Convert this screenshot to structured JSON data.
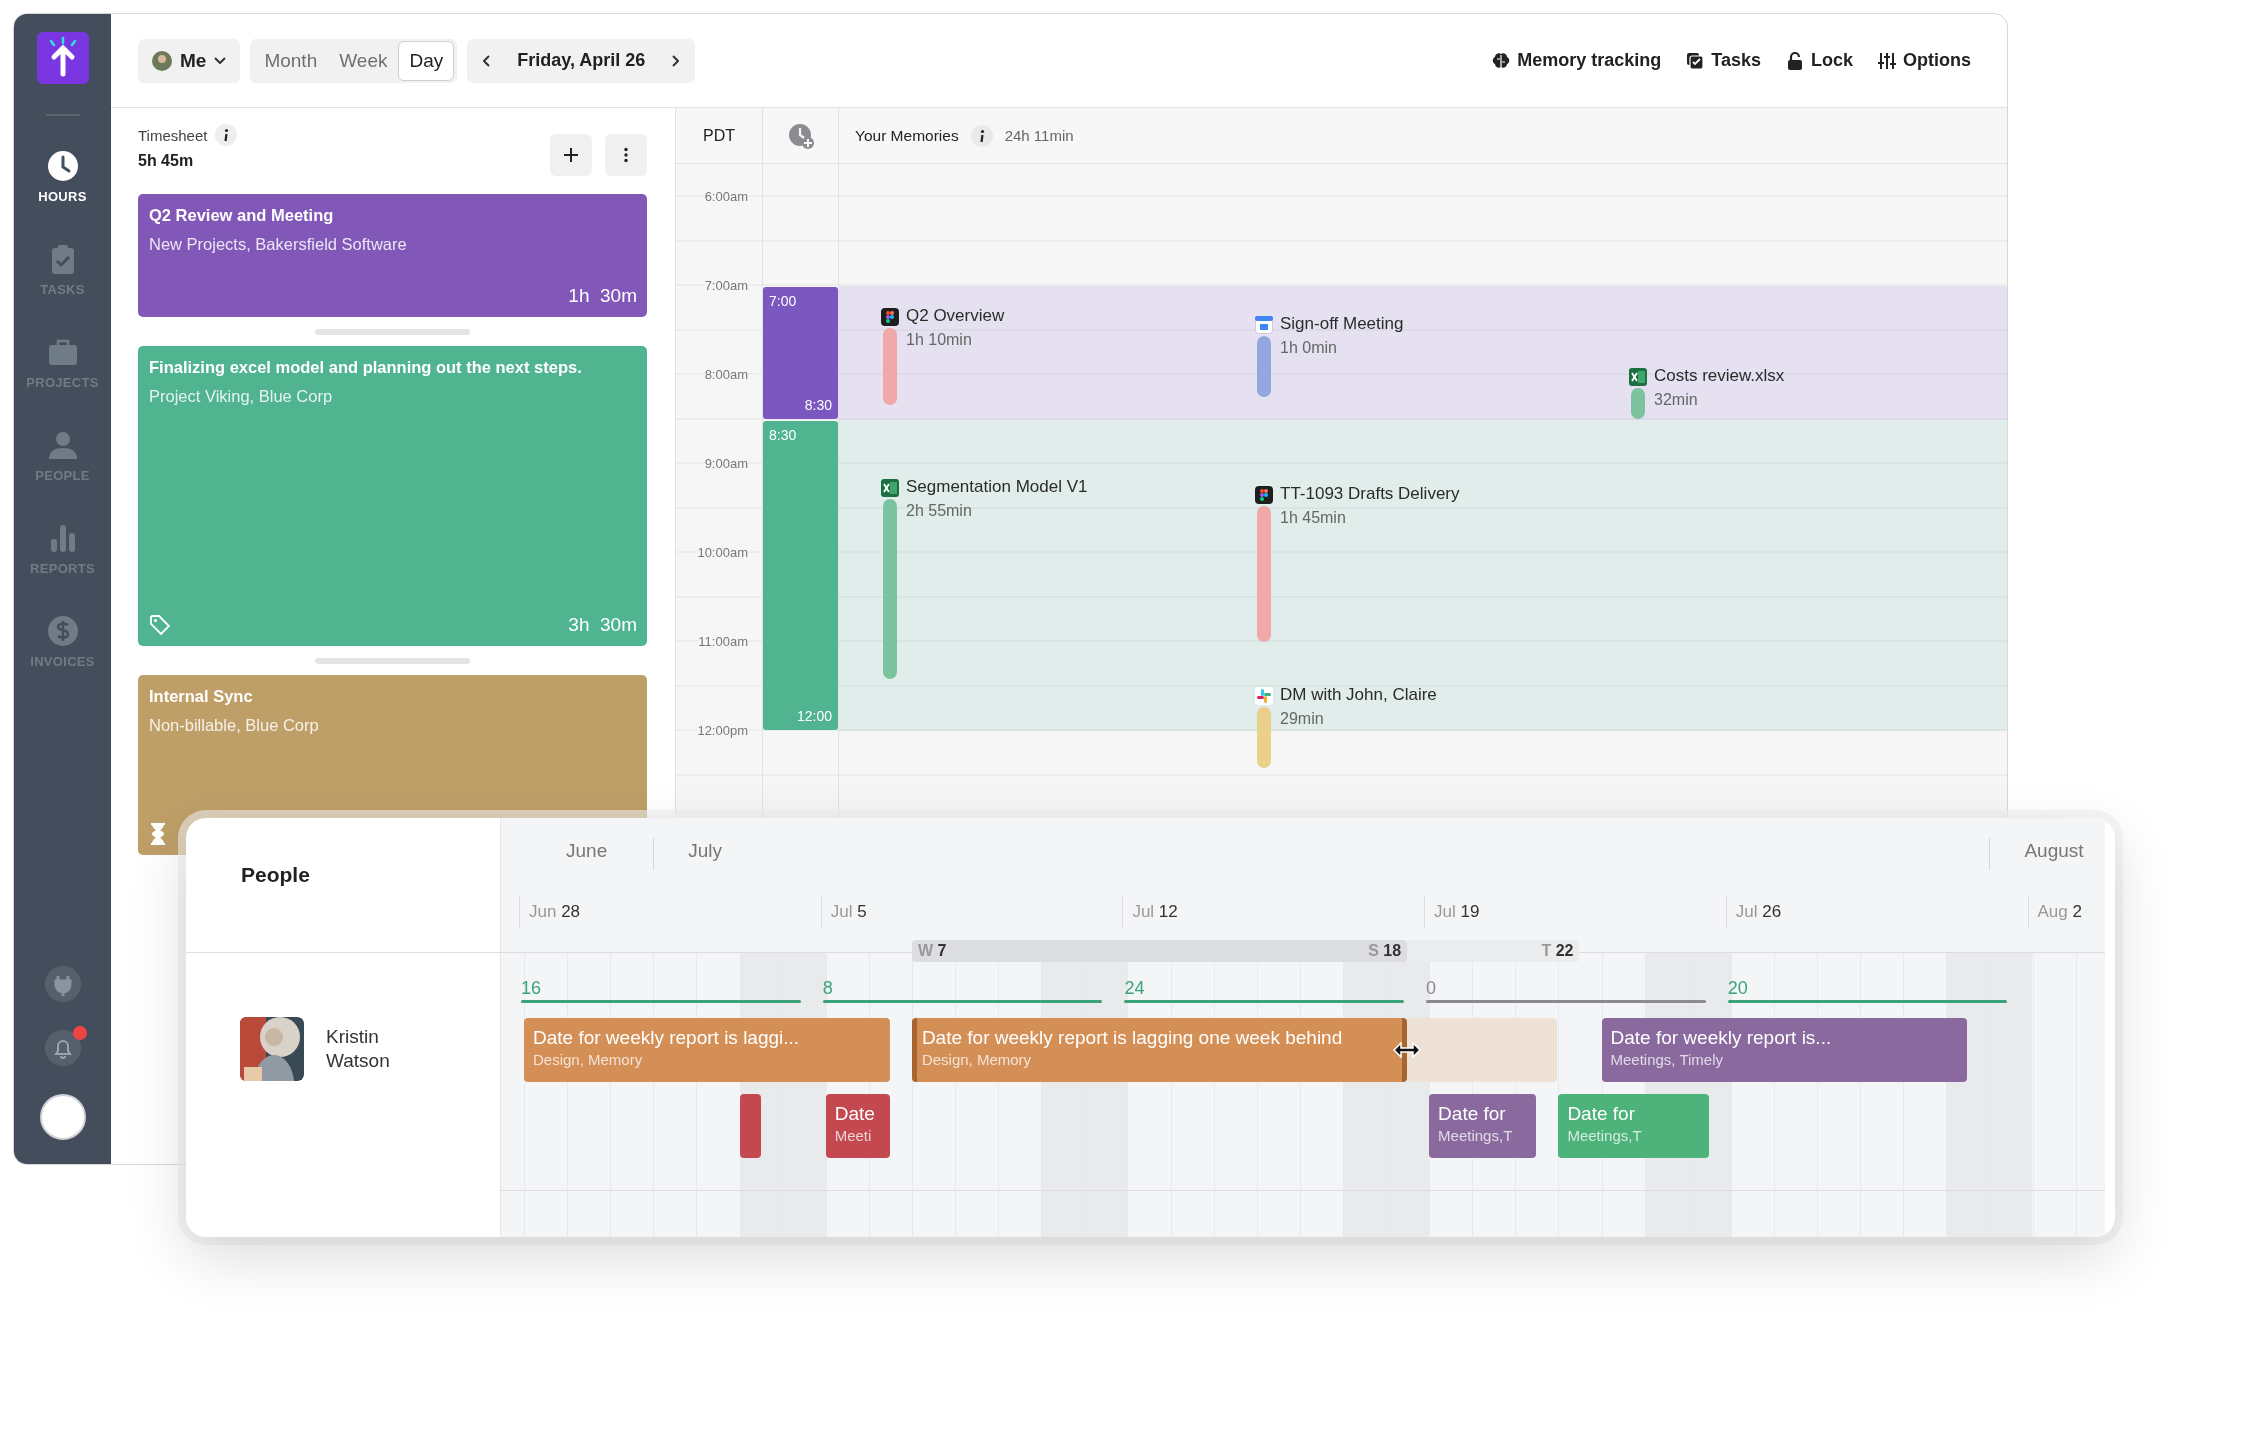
{
  "sidebar": {
    "nav": [
      {
        "label": "HOURS",
        "selected": true
      },
      {
        "label": "TASKS",
        "selected": false
      },
      {
        "label": "PROJECTS",
        "selected": false
      },
      {
        "label": "PEOPLE",
        "selected": false
      },
      {
        "label": "REPORTS",
        "selected": false
      },
      {
        "label": "INVOICES",
        "selected": false
      }
    ],
    "notifications_unread": true
  },
  "toolbar": {
    "user": "Me",
    "views": [
      {
        "label": "Month",
        "selected": false
      },
      {
        "label": "Week",
        "selected": false
      },
      {
        "label": "Day",
        "selected": true
      }
    ],
    "date": "Friday, April 26",
    "actions": [
      {
        "label": "Memory tracking"
      },
      {
        "label": "Tasks"
      },
      {
        "label": "Lock"
      },
      {
        "label": "Options"
      }
    ]
  },
  "timesheet": {
    "title": "Timesheet",
    "total": "5h 45m",
    "entries": [
      {
        "title": "Q2 Review and Meeting",
        "subtitle": "New Projects, Bakersfield Software",
        "duration": "1h  30m",
        "color": "#8157b8"
      },
      {
        "title": "Finalizing excel model and planning out the next steps.",
        "subtitle": "Project Viking, Blue Corp",
        "duration": "3h  30m",
        "color": "#50b490"
      },
      {
        "title": "Internal Sync",
        "subtitle": "Non-billable, Blue Corp",
        "color": "#bf9f68"
      }
    ]
  },
  "calendar": {
    "timezone": "PDT",
    "title": "Your Memories",
    "total": "24h 11min",
    "hours": [
      "6:00am",
      "7:00am",
      "8:00am",
      "9:00am",
      "10:00am",
      "11:00am",
      "12:00pm"
    ],
    "blocks": [
      {
        "start": "7:00",
        "end": "8:30",
        "color": "#7b57c0"
      },
      {
        "start": "8:30",
        "end": "12:00",
        "color": "#4fb48f"
      }
    ],
    "lanes": [
      [
        {
          "title": "Q2 Overview",
          "duration": "1h 10min",
          "color": "#f0a8a8"
        },
        {
          "title": "Segmentation Model V1",
          "duration": "2h 55min",
          "color": "#7cc4a0"
        }
      ],
      [
        {
          "title": "Sign-off Meeting",
          "duration": "1h 0min",
          "color": "#94a6de"
        },
        {
          "title": "TT-1093 Drafts Delivery",
          "duration": "1h 45min",
          "color": "#f0a8a8"
        },
        {
          "title": "DM with John, Claire",
          "duration": "29min",
          "color": "#ead089"
        }
      ],
      [
        {
          "title": "Costs review.xlsx",
          "duration": "32min",
          "color": "#7cc4a0"
        }
      ]
    ]
  },
  "people": {
    "title": "People",
    "months": [
      {
        "label": "June"
      },
      {
        "label": "July"
      },
      {
        "label": "August"
      }
    ],
    "weeks": [
      {
        "month": "Jun",
        "day": "28"
      },
      {
        "month": "Jul",
        "day": "5"
      },
      {
        "month": "Jul",
        "day": "12"
      },
      {
        "month": "Jul",
        "day": "19"
      },
      {
        "month": "Jul",
        "day": "26"
      },
      {
        "month": "Aug",
        "day": "2"
      }
    ],
    "range_marker": {
      "start_prefix": "W",
      "start_day": "7",
      "end_prefix": "S",
      "end_day": "18",
      "extension": {
        "prefix": "T",
        "day": "22"
      }
    },
    "person": {
      "name": "Kristin Watson",
      "week_totals": [
        {
          "value": "16",
          "color": "#3aa37a"
        },
        {
          "value": "8",
          "color": "#3aa37a"
        },
        {
          "value": "24",
          "color": "#3aa37a"
        },
        {
          "value": "0",
          "color": "#8a8a90"
        },
        {
          "value": "20",
          "color": "#3aa37a"
        }
      ],
      "task_rows": [
        [
          {
            "kind": "bar",
            "title": "Date for weekly report is laggi...",
            "subtitle": "Design, Memory",
            "color": "#d48f57",
            "resizing": false
          },
          {
            "kind": "bar",
            "title": "Date for weekly report is lagging one week behind",
            "subtitle": "Design, Memory",
            "color": "#d48f57",
            "resizing": true
          },
          {
            "kind": "ghost",
            "color": "#eee1d5"
          },
          {
            "kind": "bar",
            "title": "Date for weekly report is...",
            "subtitle": "Meetings, Timely",
            "color": "#8a6a9e",
            "resizing": false
          }
        ],
        [
          {
            "kind": "bar",
            "color": "#c4484f",
            "resizing": false
          },
          {
            "kind": "bar",
            "title": "Date",
            "subtitle": "Meeti",
            "color": "#c4484f",
            "resizing": false
          },
          {
            "kind": "bar",
            "title": "Date for",
            "subtitle": "Meetings,T",
            "color": "#8a6a9e",
            "resizing": false
          },
          {
            "kind": "bar",
            "title": "Date for",
            "subtitle": "Meetings,T",
            "color": "#4db37a",
            "resizing": false
          }
        ]
      ]
    }
  }
}
